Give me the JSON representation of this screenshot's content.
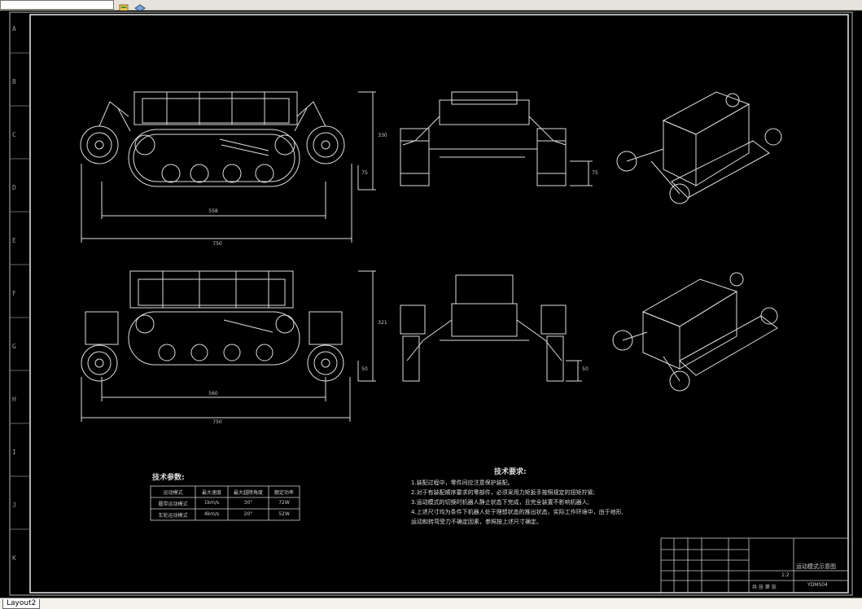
{
  "toolbar": {
    "layer_field": "",
    "icons": [
      "layer-state-icon",
      "layer-properties-icon"
    ]
  },
  "sheet": {
    "zone_letters": [
      "A",
      "B",
      "C",
      "D",
      "E",
      "F",
      "G",
      "H",
      "I",
      "J",
      "K"
    ],
    "dims": {
      "top_overall": "750",
      "top_inner": "558",
      "top_height": "330",
      "top_clear": "75",
      "front_clear": "75",
      "bot_overall": "750",
      "bot_inner": "560",
      "bot_height": "321",
      "bot_clear": "50",
      "bot_front_clear": "50"
    }
  },
  "params": {
    "title": "技术参数:",
    "headers": [
      "运动模式",
      "最大速度",
      "最大越障角度",
      "额定功率"
    ],
    "rows": [
      [
        "履带运动模式",
        "1km/s",
        "30°",
        "72W"
      ],
      [
        "车轮运动模式",
        "4km/s",
        "20°",
        "52W"
      ]
    ]
  },
  "requirements": {
    "title": "技术要求:",
    "lines": [
      "1.装配过程中，零件间应注意保护装配。",
      "2.对于有装配顺序要求的零部件，必须采用力矩扳手按照规定的扭矩拧紧;",
      "3.运动模式的切换时机器人静止状态下完成，且完全装置不影响机器人;",
      "4.上述尺寸均为条件下机器人处于理想状态的推出状态，实际工作环境中，由于地形,",
      "运动和转弯受力不确定因素，参照按上述尺寸确定。"
    ]
  },
  "titleblock": {
    "drawing_name": "运动模式示意图",
    "drawing_code": "YDMS04",
    "scale": "1:2",
    "sheet_info": "共 张 第 张"
  },
  "statusbar": {
    "layout_tab": "Layout2"
  }
}
